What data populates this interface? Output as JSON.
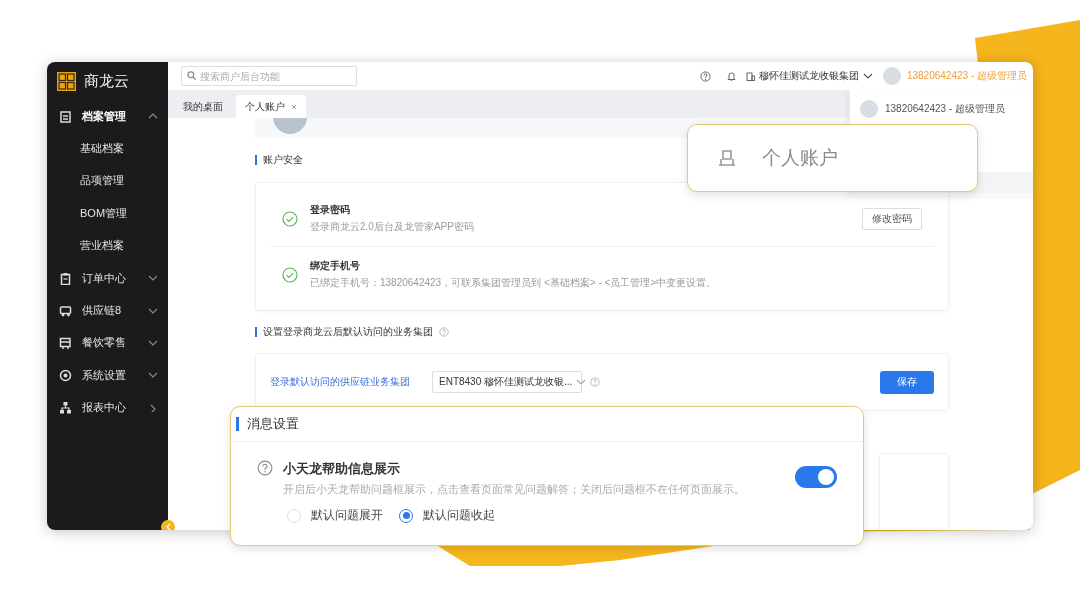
{
  "sidebar": {
    "brand": "商龙云",
    "items": [
      {
        "label": "档案管理",
        "kind": "group",
        "expanded": true,
        "children": [
          {
            "label": "基础档案"
          },
          {
            "label": "品项管理"
          },
          {
            "label": "BOM管理"
          },
          {
            "label": "营业档案"
          }
        ]
      },
      {
        "label": "订单中心",
        "kind": "group",
        "expanded": false
      },
      {
        "label": "供应链8",
        "kind": "group",
        "expanded": false
      },
      {
        "label": "餐饮零售",
        "kind": "group",
        "expanded": false
      },
      {
        "label": "系统设置",
        "kind": "group",
        "expanded": false
      },
      {
        "label": "报表中心",
        "kind": "page",
        "expanded": false
      }
    ]
  },
  "topbar": {
    "search": {
      "placeholder": "搜索商户后台功能"
    },
    "org": "穆怀佳测试龙收银集团",
    "user": "13820642423 - 超级管理员"
  },
  "tabs": [
    {
      "label": "我的桌面",
      "selected": false,
      "closable": false
    },
    {
      "label": "个人账户",
      "selected": true,
      "closable": true
    }
  ],
  "security": {
    "title": "账户安全",
    "items": [
      {
        "title": "登录密码",
        "description": "登录商龙云2.0后台及龙管家APP密码",
        "verified": true,
        "action": "修改密码"
      },
      {
        "title": "绑定手机号",
        "description": "已绑定手机号：13820642423，可联系集团管理员到 <基础档案> - <员工管理>中变更设置。",
        "verified": true
      }
    ]
  },
  "default_group": {
    "title": "设置登录商龙云后默认访问的业务集团",
    "label": "登录默认访问的供应链业务集团",
    "select_value": "ENT8430 穆怀佳测试龙收银...",
    "save": "保存"
  },
  "user_panel": {
    "user": "13820642423 - 超级管理员"
  },
  "account_callout": {
    "label": "个人账户"
  },
  "message_callout": {
    "title": "消息设置",
    "option": {
      "title": "小天龙帮助信息展示",
      "description": "开启后小天龙帮助问题框展示，点击查看页面常见问题解答；关闭后问题框不在任何页面展示。",
      "on": true
    },
    "radios": [
      {
        "label": "默认问题展开",
        "selected": false
      },
      {
        "label": "默认问题收起",
        "selected": true
      }
    ]
  }
}
